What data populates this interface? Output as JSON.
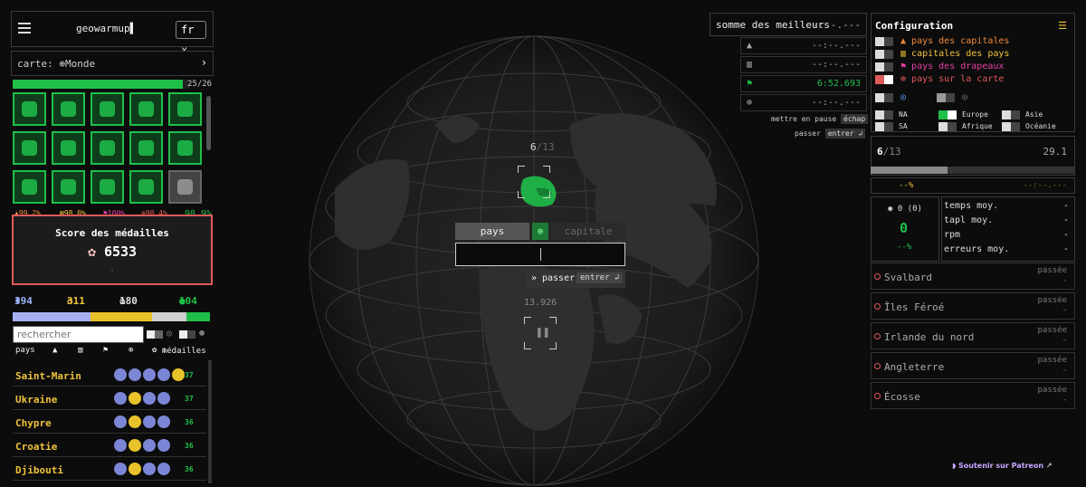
{
  "app": {
    "brand": "geowarmup▌",
    "language": "fr"
  },
  "map": {
    "label": "carte:",
    "value": "Monde"
  },
  "collection_progress": {
    "text": "25/26",
    "fraction": 0.96
  },
  "accuracy": {
    "capitals": "99.2%",
    "capital_cities": "98.0%",
    "flags": "100%",
    "map": "98.4%",
    "overall": "98.9%"
  },
  "medals": {
    "title": "Score des médailles",
    "score": "6533",
    "dash": "-"
  },
  "counts": {
    "diamond": "394",
    "gold": "311",
    "silver": "180",
    "green": "104"
  },
  "search": {
    "placeholder": "rechercher"
  },
  "table": {
    "headers": {
      "country": "pays",
      "medals": "médailles"
    },
    "rows": [
      {
        "name": "Saint-Marin",
        "points": "37"
      },
      {
        "name": "Ukraine",
        "points": "37"
      },
      {
        "name": "Chypre",
        "points": "36"
      },
      {
        "name": "Croatie",
        "points": "36"
      },
      {
        "name": "Djibouti",
        "points": "36"
      }
    ]
  },
  "game": {
    "progress_current": "6",
    "progress_total": "/13",
    "mode_country": "pays",
    "mode_capital": "capitale",
    "skip_label": "passer",
    "skip_key": "entrer ↲",
    "timer": "13.926"
  },
  "best": {
    "title": "somme des meilleurs",
    "total": "--:--.---",
    "rows": [
      "--:--.---",
      "--:--.---",
      "6:52.693",
      "--:--.---"
    ]
  },
  "hints": {
    "pause": "mettre en pause",
    "pause_key": "échap",
    "skip": "passer",
    "skip_key": "entrer ↲"
  },
  "config": {
    "title": "Configuration",
    "options": [
      "pays des capitales",
      "capitales des pays",
      "pays des drapeaux",
      "pays sur la carte"
    ],
    "option_colors": [
      "#f08a3c",
      "#f0c23b",
      "#e93fa8",
      "#e05a5a"
    ],
    "regions": [
      "NA",
      "Europe",
      "Asie",
      "SA",
      "Afrique",
      "Océanie"
    ]
  },
  "session": {
    "progress": "6",
    "total": "/13",
    "time": "29.1",
    "percent": "--%",
    "time_best": "--:--.---",
    "streak": "0 (0)",
    "big": "0",
    "pct2": "--%",
    "stats": [
      {
        "label": "temps moy.",
        "value": "-"
      },
      {
        "label": "tapl moy.",
        "value": "-"
      },
      {
        "label": "rpm",
        "value": "-"
      },
      {
        "label": "erreurs moy.",
        "value": "-"
      }
    ]
  },
  "passed": {
    "status": "passée",
    "dash": "-",
    "items": [
      "Svalbard",
      "Îles Féroé",
      "Irlande du nord",
      "Angleterre",
      "Écosse"
    ]
  },
  "patreon": "Soutenir sur Patreon"
}
